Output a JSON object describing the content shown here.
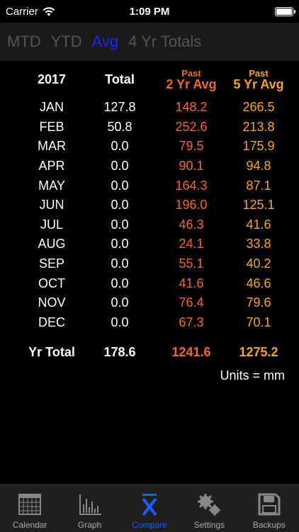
{
  "status": {
    "carrier": "Carrier",
    "time": "1:09 PM",
    "battery_level": 1.0
  },
  "segments": [
    {
      "label": "MTD",
      "active": false
    },
    {
      "label": "YTD",
      "active": false
    },
    {
      "label": "Avg",
      "active": true
    },
    {
      "label": "4 Yr Totals",
      "active": false
    }
  ],
  "table": {
    "year": "2017",
    "total_header": "Total",
    "past2_top": "Past",
    "past2_bottom": "2 Yr Avg",
    "past5_top": "Past",
    "past5_bottom": "5 Yr Avg",
    "rows": [
      {
        "month": "JAN",
        "total": "127.8",
        "avg2": "148.2",
        "avg5": "266.5"
      },
      {
        "month": "FEB",
        "total": "50.8",
        "avg2": "252.6",
        "avg5": "213.8"
      },
      {
        "month": "MAR",
        "total": "0.0",
        "avg2": "79.5",
        "avg5": "175.9"
      },
      {
        "month": "APR",
        "total": "0.0",
        "avg2": "90.1",
        "avg5": "94.8"
      },
      {
        "month": "MAY",
        "total": "0.0",
        "avg2": "164.3",
        "avg5": "87.1"
      },
      {
        "month": "JUN",
        "total": "0.0",
        "avg2": "196.0",
        "avg5": "125.1"
      },
      {
        "month": "JUL",
        "total": "0.0",
        "avg2": "46.3",
        "avg5": "41.6"
      },
      {
        "month": "AUG",
        "total": "0.0",
        "avg2": "24.1",
        "avg5": "33.8"
      },
      {
        "month": "SEP",
        "total": "0.0",
        "avg2": "55.1",
        "avg5": "40.2"
      },
      {
        "month": "OCT",
        "total": "0.0",
        "avg2": "41.6",
        "avg5": "46.6"
      },
      {
        "month": "NOV",
        "total": "0.0",
        "avg2": "76.4",
        "avg5": "79.6"
      },
      {
        "month": "DEC",
        "total": "0.0",
        "avg2": "67.3",
        "avg5": "70.1"
      }
    ],
    "yr_total_label": "Yr Total",
    "yr_total": "178.6",
    "yr_total_2": "1241.6",
    "yr_total_5": "1275.2"
  },
  "units": "Units = mm",
  "tabs": [
    {
      "label": "Calendar",
      "icon": "calendar-icon",
      "active": false
    },
    {
      "label": "Graph",
      "icon": "bar-graph-icon",
      "active": false
    },
    {
      "label": "Compare",
      "icon": "x-bar-icon",
      "active": true
    },
    {
      "label": "Settings",
      "icon": "gears-icon",
      "active": false
    },
    {
      "label": "Backups",
      "icon": "floppy-disk-icon",
      "active": false
    }
  ],
  "colors": {
    "two_yr": "#f06a2c",
    "five_yr": "#f5a71d",
    "accent": "#1b28ff"
  }
}
